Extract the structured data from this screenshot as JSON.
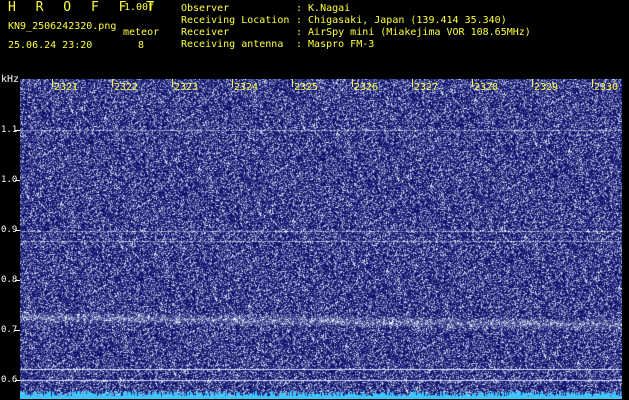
{
  "header": {
    "app_title": "H R O F F T",
    "version": "1.00f",
    "filename": "KN9_2506242320.png",
    "meteor_label": "meteor",
    "meteor_count": "8",
    "timestamp": "25.06.24 23:20"
  },
  "info": [
    {
      "key": "Observer",
      "value": ": K.Nagai"
    },
    {
      "key": "Receiving Location",
      "value": ": Chigasaki, Japan (139.414 35.340)"
    },
    {
      "key": "Receiver",
      "value": ": AirSpy mini (Miakejima VOR 108.65MHz)"
    },
    {
      "key": "Receiving antenna",
      "value": ": Maspro FM-3"
    }
  ],
  "spectrogram": {
    "y_unit": "kHz",
    "y_labels": [
      "1.1",
      "1.0",
      "0.9",
      "0.8",
      "0.7",
      "0.6"
    ],
    "x_labels": [
      "2321",
      "2322",
      "2323",
      "2324",
      "2325",
      "2326",
      "2327",
      "2328",
      "2329",
      "2330"
    ],
    "colors": {
      "background": "#0a0c6a",
      "signal": "#5aa8ff",
      "label": "#ffff3c"
    }
  }
}
